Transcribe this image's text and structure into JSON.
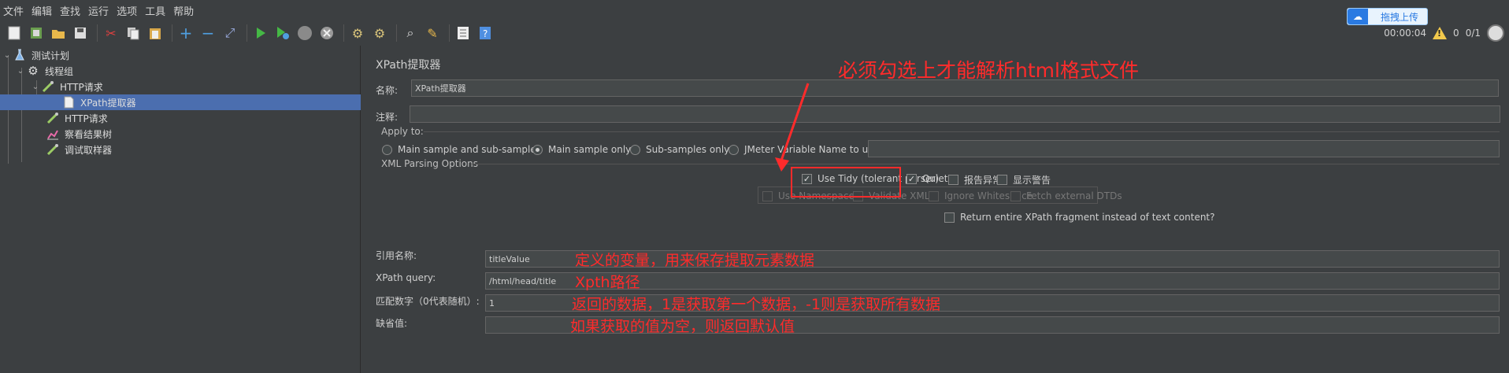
{
  "menubar": {
    "items": [
      "文件",
      "编辑",
      "查找",
      "运行",
      "选项",
      "工具",
      "帮助"
    ],
    "upload_label": "拖拽上传"
  },
  "toolbar": {
    "icons": [
      "new-icon",
      "templates-icon",
      "open-icon",
      "save-icon",
      "cut-icon",
      "copy-icon",
      "paste-icon",
      "expand-icon",
      "collapse-icon",
      "toggle-icon",
      "start-icon",
      "start-no-pause-icon",
      "stop-icon",
      "shutdown-icon",
      "clear-icon",
      "clear-all-icon",
      "search-icon",
      "reset-search-icon",
      "function-helper-icon",
      "help-icon"
    ],
    "timer": "00:00:04",
    "warnings": "0",
    "threads": "0/1"
  },
  "tree": {
    "items": [
      {
        "label": "测试计划",
        "level": 0,
        "icon": "test-plan-icon",
        "expanded": true,
        "selected": false
      },
      {
        "label": "线程组",
        "level": 1,
        "icon": "gear-icon",
        "expanded": true,
        "selected": false
      },
      {
        "label": "HTTP请求",
        "level": 2,
        "icon": "pipette-icon",
        "expanded": true,
        "selected": false
      },
      {
        "label": "XPath提取器",
        "level": 3,
        "icon": "document-icon",
        "expanded": false,
        "selected": true
      },
      {
        "label": "HTTP请求",
        "level": 2,
        "icon": "pipette-icon",
        "expanded": false,
        "selected": false
      },
      {
        "label": "察看结果树",
        "level": 2,
        "icon": "chart-icon",
        "expanded": false,
        "selected": false
      },
      {
        "label": "调试取样器",
        "level": 2,
        "icon": "pipette-icon",
        "expanded": false,
        "selected": false
      }
    ]
  },
  "panel": {
    "title": "XPath提取器",
    "name_label": "名称:",
    "name_value": "XPath提取器",
    "comment_label": "注释:",
    "comment_value": "",
    "apply_to": {
      "title": "Apply to:",
      "options": [
        {
          "label": "Main sample and sub-samples",
          "checked": false
        },
        {
          "label": "Main sample only",
          "checked": true
        },
        {
          "label": "Sub-samples only",
          "checked": false
        },
        {
          "label": "JMeter Variable Name to use",
          "checked": false
        }
      ],
      "variable_value": ""
    },
    "xml_options": {
      "title": "XML Parsing Options",
      "row1": [
        {
          "label": "Use Tidy (tolerant parser)",
          "checked": true
        },
        {
          "label": "Quiet",
          "checked": true
        },
        {
          "label": "报告异常",
          "checked": false
        },
        {
          "label": "显示警告",
          "checked": false
        }
      ],
      "row2": [
        {
          "label": "Use Namespaces",
          "checked": false
        },
        {
          "label": "Validate XML",
          "checked": false
        },
        {
          "label": "Ignore Whitespace",
          "checked": false
        },
        {
          "label": "Fetch external DTDs",
          "checked": false
        }
      ],
      "fragment": {
        "label": "Return entire XPath fragment instead of text content?",
        "checked": false
      }
    },
    "ref_name_label": "引用名称:",
    "ref_name_value": "titleValue",
    "xpath_label": "XPath query:",
    "xpath_value": "/html/head/title",
    "match_label": "匹配数字（0代表随机）:",
    "match_value": "1",
    "default_label": "缺省值:",
    "default_value": ""
  },
  "annotations": {
    "tidy_note": "必须勾选上才能解析html格式文件",
    "ref_note": "定义的变量，用来保存提取元素数据",
    "xpath_note": "Xpth路径",
    "match_note": "返回的数据，1是获取第一个数据，-1则是获取所有数据",
    "default_note": "如果获取的值为空，则返回默认值",
    "color": "#ff2b2b"
  }
}
